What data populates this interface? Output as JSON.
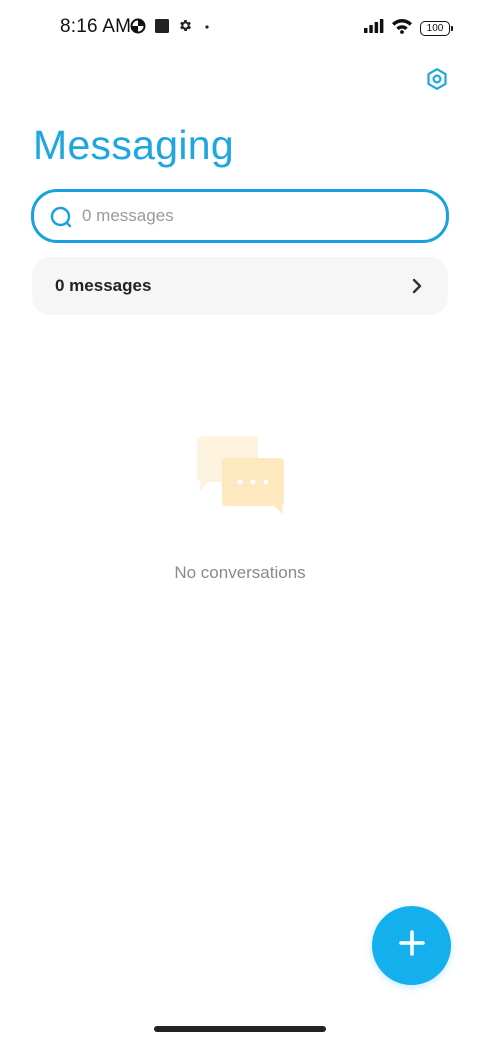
{
  "status_bar": {
    "time": "8:16 AM",
    "battery_level": "100",
    "icons": [
      "data-saver-icon",
      "square-notification-icon",
      "gear-notification-icon",
      "dot-icon",
      "signal-icon",
      "wifi-icon",
      "battery-icon"
    ]
  },
  "header": {
    "title": "Messaging",
    "settings_icon": "settings-hexagon-icon"
  },
  "search": {
    "placeholder": "0 messages",
    "value": "",
    "icon": "search-icon"
  },
  "messages_row": {
    "label": "0 messages",
    "icon": "chevron-right-icon"
  },
  "empty_state": {
    "text": "No conversations",
    "icon": "chat-bubbles-icon"
  },
  "fab": {
    "icon": "plus-icon"
  },
  "colors": {
    "accent": "#1ea6e0",
    "fab": "#14b0ee",
    "row_background": "#f6f6f6",
    "illustration_light": "#fdf3de",
    "illustration_dark": "#fde6b8"
  }
}
